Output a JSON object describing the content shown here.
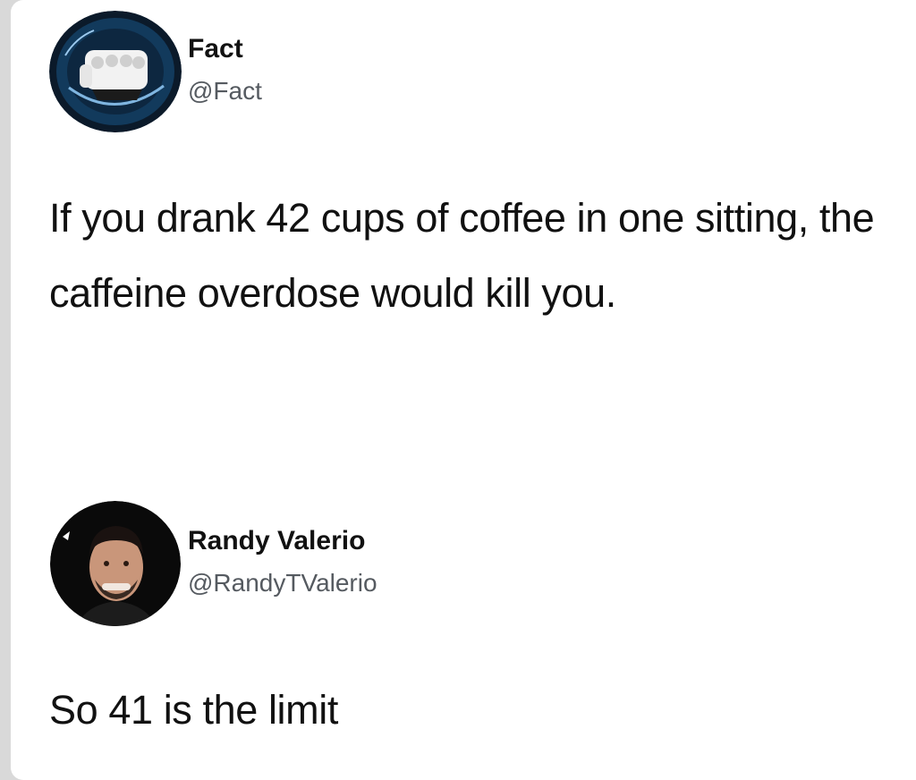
{
  "colors": {
    "background": "#ffffff",
    "text": "#111111",
    "handle": "#555a60"
  },
  "tweet": {
    "author_name": "Fact",
    "author_handle": "@Fact",
    "avatar_icon": "fact-logo-icon",
    "text": "If you drank 42 cups of coffee in one sitting, the caffeine overdose would kill you."
  },
  "reply": {
    "author_name": "Randy Valerio",
    "author_handle": "@RandyTValerio",
    "avatar_icon": "user-photo-avatar",
    "text": "So 41 is the limit"
  }
}
